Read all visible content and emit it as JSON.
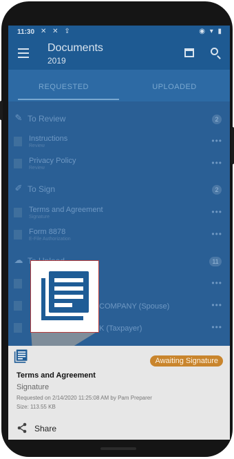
{
  "status_bar": {
    "time": "11:30",
    "notification_icons": [
      "missed-call-icon",
      "missed-call-icon",
      "upload-icon"
    ],
    "system_icons": [
      "sync-icon",
      "wifi-icon",
      "battery-icon"
    ]
  },
  "app_bar": {
    "title": "Documents",
    "subtitle": "2019",
    "icons": [
      "menu-icon",
      "calendar-icon",
      "search-icon"
    ]
  },
  "tabs": [
    {
      "label": "REQUESTED",
      "selected": true
    },
    {
      "label": "UPLOADED",
      "selected": false
    }
  ],
  "sections": {
    "review": {
      "label": "To Review",
      "count": "2",
      "items": [
        {
          "name": "Instructions",
          "sub": "Review"
        },
        {
          "name": "Privacy Policy",
          "sub": "Review"
        }
      ]
    },
    "sign": {
      "label": "To Sign",
      "count": "2",
      "items": [
        {
          "name": "Terms and Agreement",
          "sub": "Signature"
        },
        {
          "name": "Form 8878",
          "sub": "E-File Authorization"
        }
      ]
    },
    "upload": {
      "label": "To Upload",
      "count": "11",
      "items": [
        {
          "name": "COMPANY (Spouse)"
        },
        {
          "name": "K (Taxpayer)"
        }
      ]
    }
  },
  "sheet": {
    "badge": "Awaiting Signature",
    "title": "Terms and Agreement",
    "subtitle": "Signature",
    "requested": "Requested on 2/14/2020 11:25:08 AM by Pam Preparer",
    "size": "Size: 113.55 KB",
    "share_label": "Share"
  },
  "colors": {
    "primary": "#1e5a92",
    "badge": "#c9852d",
    "sheet": "#e7e7e7",
    "callout_border": "#b73b3b"
  }
}
